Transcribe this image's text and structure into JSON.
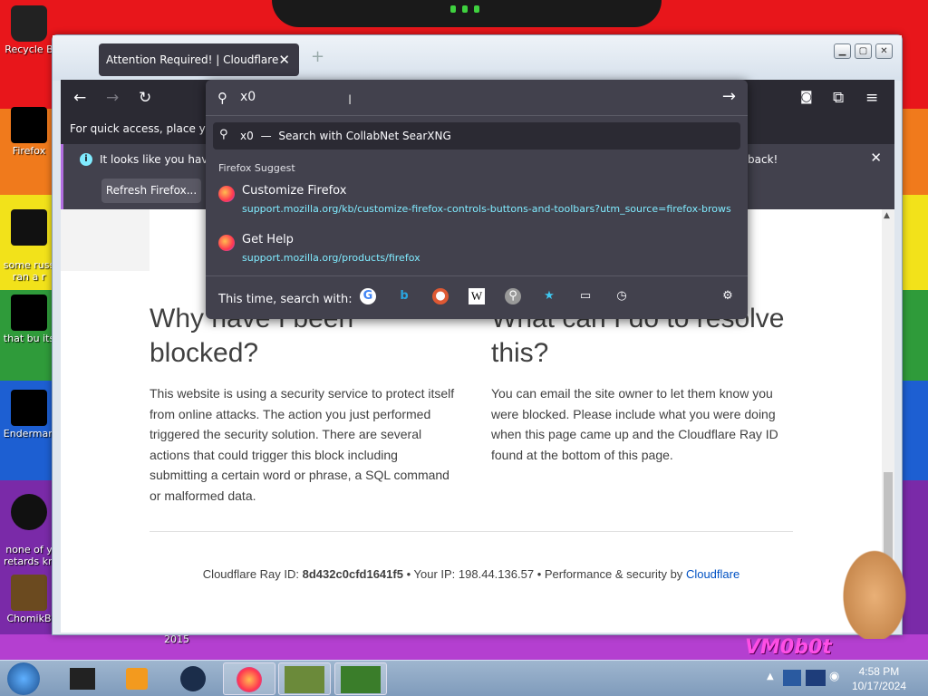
{
  "desktop": {
    "icons": [
      {
        "label": "Recycle B"
      },
      {
        "label": "Firefox"
      },
      {
        "label": "some russ\nran a r"
      },
      {
        "label": "that bu its"
      },
      {
        "label": "Enderman"
      },
      {
        "label": "none of y\nretards kn"
      },
      {
        "label": "ChomikB"
      }
    ],
    "bottom_text": "2015",
    "bottom_right_text": "VM0b0t"
  },
  "browser": {
    "tab_title": "Attention Required! | Cloudflare",
    "url_value": "x0",
    "bookmarks_hint": "For quick access, place your b",
    "notification": {
      "message": "It looks like you haven",
      "message_tail": "back!",
      "refresh_button": "Refresh Firefox..."
    }
  },
  "urlbar_dropdown": {
    "search_suggestion_query": "x0",
    "search_suggestion_sep": "—",
    "search_suggestion_engine": "Search with CollabNet SearXNG",
    "section_title": "Firefox Suggest",
    "suggestions": [
      {
        "title": "Customize Firefox",
        "url": "support.mozilla.org/kb/customize-firefox-controls-buttons-and-toolbars?utm_source=firefox-browser"
      },
      {
        "title": "Get Help",
        "url": "support.mozilla.org/products/firefox"
      }
    ],
    "search_with_label": "This time, search with:",
    "engines": [
      "google-icon",
      "bing-icon",
      "duckduckgo-icon",
      "wikipedia-icon",
      "searxng-icon",
      "bookmarks-icon",
      "tabs-icon",
      "history-icon"
    ]
  },
  "page": {
    "heading_left": "Why have I been blocked?",
    "body_left": "This website is using a security service to protect itself from online attacks. The action you just performed triggered the security solution. There are several actions that could trigger this block including submitting a certain word or phrase, a SQL command or malformed data.",
    "heading_right": "What can I do to resolve this?",
    "body_right": "You can email the site owner to let them know you were blocked. Please include what you were doing when this page came up and the Cloudflare Ray ID found at the bottom of this page.",
    "footer_ray_label": "Cloudflare Ray ID:",
    "footer_ray_id": "8d432c0cfd1641f5",
    "footer_ip_label": "Your IP:",
    "footer_ip": "198.44.136.57",
    "footer_perf": "Performance & security by",
    "footer_link": "Cloudflare"
  },
  "taskbar": {
    "time": "4:58 PM",
    "date": "10/17/2024"
  },
  "colors": {
    "firefox_dark": "#2b2a33",
    "popup": "#42414d",
    "link_cyan": "#80ebff",
    "cloudflare_link": "#0051c3"
  }
}
